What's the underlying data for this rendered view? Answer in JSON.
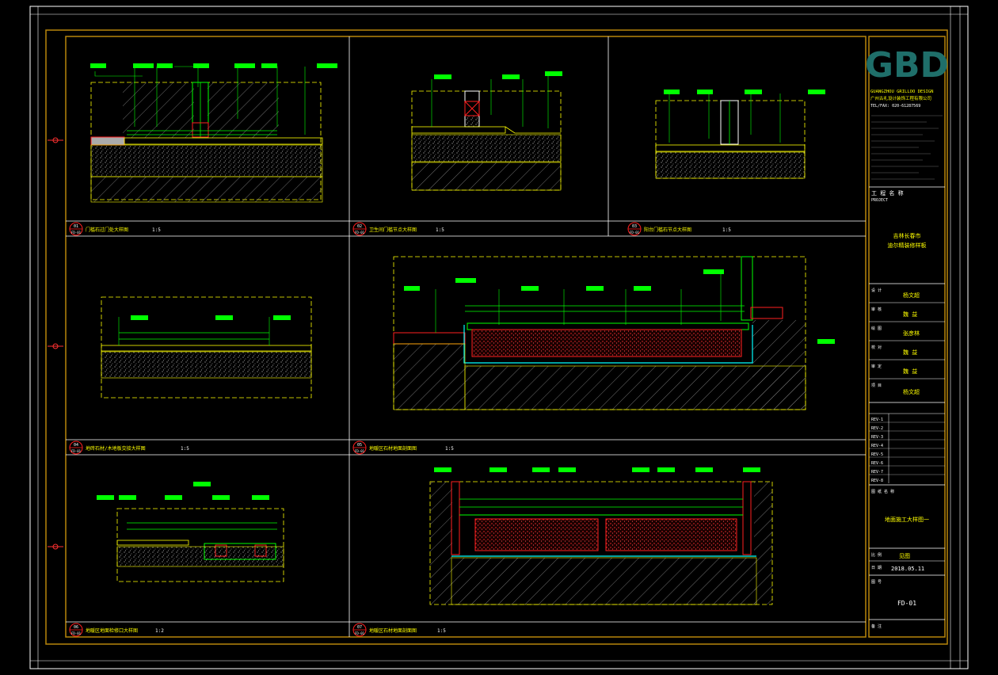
{
  "colors": {
    "background": "#000000",
    "frame_gold": "#b8860b",
    "line_yellow": "#ffff00",
    "line_green": "#00ff00",
    "line_white": "#ffffff",
    "line_red": "#ff2020",
    "line_cyan": "#00ffff",
    "logo_teal": "#1f6f6a"
  },
  "title_block": {
    "logo_text": "GBD",
    "company_en": "GUANGZHOU GRILLOO DESIGN",
    "company_cn": "广州古礼设计装饰工程有限公司",
    "tel": "TEL/FAX: 020-61287569",
    "project_label_cn": "工 程 名 称",
    "project_label_en": "PROJECT",
    "project_name_1": "吉林长春市",
    "project_name_2": "迪尔精装修样板",
    "signature_rows": [
      {
        "label": "设 计",
        "value": "杨文超"
      },
      {
        "label": "审 核",
        "value": "魏 益"
      },
      {
        "label": "绘 图",
        "value": "张彦林"
      },
      {
        "label": "校 对",
        "value": "魏 益"
      },
      {
        "label": "审 定",
        "value": "魏 益"
      },
      {
        "label": "项 目",
        "value": "杨文超"
      }
    ],
    "revisions": [
      "REV-1",
      "REV-2",
      "REV-3",
      "REV-4",
      "REV-5",
      "REV-6",
      "REV-7",
      "REV-8"
    ],
    "drawing_title_label": "图 纸 名 称",
    "drawing_title": "地面施工大样图一",
    "scale_label": "比 例",
    "scale_value": "见图",
    "date_label": "日 期",
    "date_value": "2018.05.11",
    "number_label": "图 号",
    "drawing_number": "FD-01",
    "remark_label": "备 注"
  },
  "details": [
    {
      "num": "01",
      "sheet": "FD-01",
      "title": "门槛石过门处大样图",
      "scale": "1:5"
    },
    {
      "num": "02",
      "sheet": "FD-01",
      "title": "卫生间门槛节点大样图",
      "scale": "1:5"
    },
    {
      "num": "03",
      "sheet": "FD-01",
      "title": "阳台门槛石节点大样图",
      "scale": "1:5"
    },
    {
      "num": "04",
      "sheet": "FD-01",
      "title": "地砖石材/木地板交接大样图",
      "scale": "1:5"
    },
    {
      "num": "05",
      "sheet": "FD-01",
      "title": "地暖区石材地面剖面图",
      "scale": "1:5"
    },
    {
      "num": "06",
      "sheet": "FD-01",
      "title": "地暖区地面检修口大样图",
      "scale": "1:2"
    },
    {
      "num": "07",
      "sheet": "FD-01",
      "title": "地暖区石材地面剖面图",
      "scale": "1:5"
    }
  ]
}
